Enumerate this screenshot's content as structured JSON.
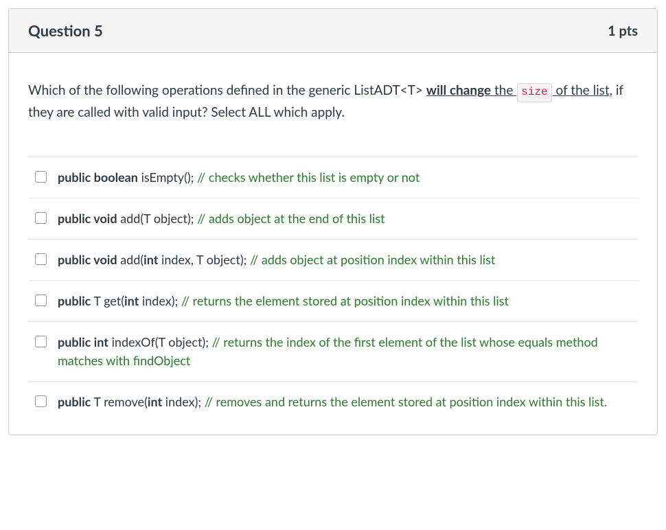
{
  "header": {
    "title": "Question 5",
    "points": "1 pts"
  },
  "prompt": {
    "part1": "Which of the following operations defined in the generic ListADT<T> ",
    "will_change": "will change",
    "the1": " the ",
    "size_code": "size",
    "of_the_list": " of the list",
    "part2": ", if they are called with valid input? Select ALL which apply."
  },
  "answers": [
    {
      "kw1": "public boolean",
      "sig": " isEmpty(); ",
      "comment": "// checks whether this list is empty or not"
    },
    {
      "kw1": "public void",
      "sig": " add(T object); ",
      "comment": "// adds object at the end of this list"
    },
    {
      "kw1": "public void",
      "sig": " add(",
      "kw2": "int",
      "sig2": " index, T object); ",
      "comment": "// adds object at position index within this list"
    },
    {
      "kw1": "public",
      "sig": " T get(",
      "kw2": "int",
      "sig2": " index); ",
      "comment": "// returns the element stored at position index within this list"
    },
    {
      "kw1": "public int",
      "sig": " indexOf(T object); ",
      "comment": "// returns the index of the first element of the list whose equals method matches with findObject"
    },
    {
      "kw1": "public",
      "sig": " T remove(",
      "kw2": "int",
      "sig2": " index); ",
      "comment": "// removes and returns the element stored at position index within this list."
    }
  ]
}
